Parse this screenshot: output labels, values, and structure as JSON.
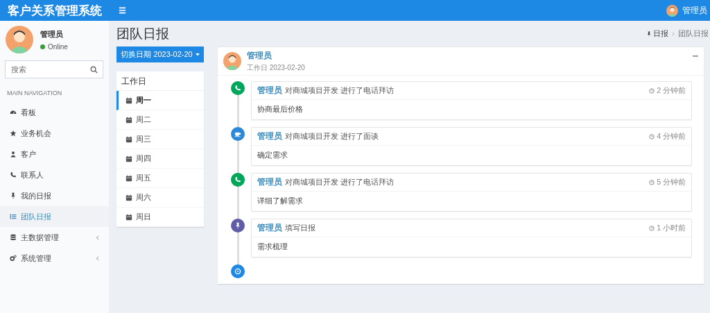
{
  "header": {
    "logo": "客户关系管理系统",
    "user": "管理员"
  },
  "sidebar": {
    "user": {
      "name": "管理员",
      "status": "Online",
      "online": true
    },
    "search": {
      "placeholder": "搜索"
    },
    "section": "MAIN NAVIGATION",
    "items": [
      {
        "label": "看板",
        "kind": "dashboard",
        "selected": false,
        "expandable": false
      },
      {
        "label": "业务机会",
        "kind": "star",
        "selected": false,
        "expandable": false
      },
      {
        "label": "客户",
        "kind": "users",
        "selected": false,
        "expandable": false
      },
      {
        "label": "联系人",
        "kind": "phone",
        "selected": false,
        "expandable": false
      },
      {
        "label": "我的日报",
        "kind": "pin",
        "selected": false,
        "expandable": false
      },
      {
        "label": "团队日报",
        "kind": "list",
        "selected": true,
        "expandable": false
      },
      {
        "label": "主数据管理",
        "kind": "database",
        "selected": false,
        "expandable": true
      },
      {
        "label": "系统管理",
        "kind": "gears",
        "selected": false,
        "expandable": true
      }
    ]
  },
  "page": {
    "title": "团队日报",
    "breadcrumb": [
      "日报",
      "团队日报"
    ]
  },
  "date_button": "切换日期 2023-02-20",
  "days": {
    "title": "工作日",
    "items": [
      {
        "label": "周一",
        "selected": true
      },
      {
        "label": "周二",
        "selected": false
      },
      {
        "label": "周三",
        "selected": false
      },
      {
        "label": "周四",
        "selected": false
      },
      {
        "label": "周五",
        "selected": false
      },
      {
        "label": "周六",
        "selected": false
      },
      {
        "label": "周日",
        "selected": false
      }
    ]
  },
  "report": {
    "user": "管理员",
    "subtitle": "工作日 2023-02-20",
    "timeline": [
      {
        "kind": "phone",
        "color": "#00a65a",
        "user": "管理员",
        "action": "对商城项目开发 进行了电话拜访",
        "time": "2 分钟前",
        "body": "协商最后价格"
      },
      {
        "kind": "coffee",
        "color": "#2b88d8",
        "user": "管理员",
        "action": "对商城项目开发 进行了面谈",
        "time": "4 分钟前",
        "body": "确定需求"
      },
      {
        "kind": "phone",
        "color": "#00a65a",
        "user": "管理员",
        "action": "对商城项目开发 进行了电话拜访",
        "time": "5 分钟前",
        "body": "详细了解需求"
      },
      {
        "kind": "pin",
        "color": "#605ca8",
        "user": "管理员",
        "action": "填写日报",
        "time": "1 小时前",
        "body": "需求梳理"
      }
    ]
  }
}
